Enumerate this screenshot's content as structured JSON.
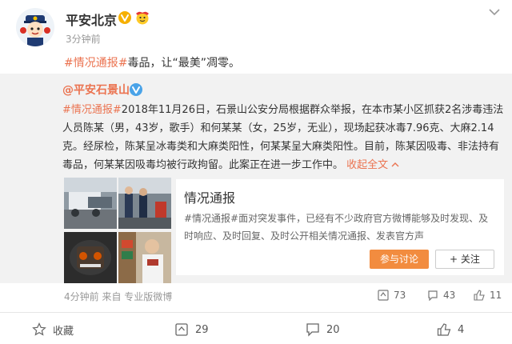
{
  "post": {
    "author": "平安北京",
    "time": "3分钟前",
    "hashtag": "#情况通报#",
    "text": "毒品，让“最美”凋零。"
  },
  "repost": {
    "author_at": "@",
    "author_name": "平安石景山",
    "hashtag": "#情况通报#",
    "text": "2018年11月26日，石景山公安分局根据群众举报，在本市某小区抓获2名涉毒违法人员陈某（男，43岁，歌手）和何某某（女，25岁，无业），现场起获冰毒7.96克、大麻2.14克。经尿检，陈某呈冰毒类和大麻类阳性，何某某呈大麻类阳性。目前，陈某因吸毒、非法持有毒品，何某某因吸毒均被行政拘留。此案正在进一步工作中。",
    "collapse_label": "收起全文",
    "meta": "4分钟前 来自 专业版微博",
    "stats": {
      "reposts": "73",
      "comments": "43",
      "likes": "11"
    },
    "card": {
      "title": "情况通报",
      "body": "#情况通报#面对突发事件，已经有不少政府官方微博能够及时发现、及时响应、及时回复、及时公开相关情况通报、发表官方声",
      "discuss_label": "参与讨论",
      "follow_label": "关注"
    }
  },
  "actions": {
    "favorite": "收藏",
    "repost": "29",
    "comment": "20",
    "like": "4"
  },
  "colors": {
    "accent": "#eb7350",
    "discuss_button": "#f28c3f",
    "repost_bg": "#f2f2f2",
    "verified": "#f6b000"
  },
  "icons": {
    "avatar": "police-mascot-avatar",
    "verified": "verified-v-icon",
    "emoji": "emoji-badge-icon",
    "more": "chevron-down-icon",
    "repost": "repost-icon",
    "comment": "comment-icon",
    "like": "thumbs-up-icon",
    "favorite": "star-icon"
  }
}
